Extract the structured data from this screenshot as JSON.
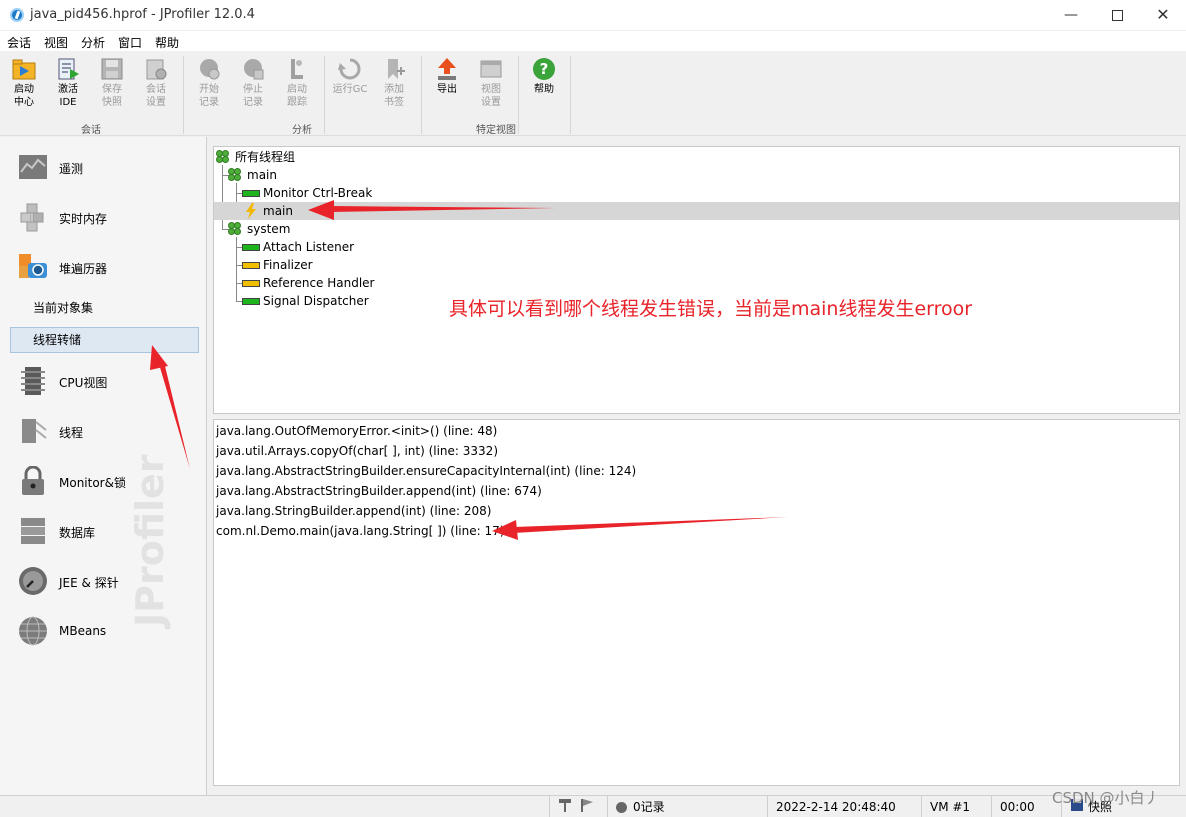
{
  "window": {
    "title": "java_pid456.hprof - JProfiler 12.0.4"
  },
  "menu": [
    "会话",
    "视图",
    "分析",
    "窗口",
    "帮助"
  ],
  "toolbar": {
    "buttons": [
      {
        "line1": "启动",
        "line2": "中心",
        "icon": "start-center-icon",
        "enabled": true
      },
      {
        "line1": "激活",
        "line2": "IDE",
        "icon": "activate-ide-icon",
        "enabled": true
      },
      {
        "line1": "保存",
        "line2": "快照",
        "icon": "save-snapshot-icon",
        "enabled": false
      },
      {
        "line1": "会话",
        "line2": "设置",
        "icon": "session-settings-icon",
        "enabled": false
      },
      {
        "line1": "开始",
        "line2": "记录",
        "icon": "start-recording-icon",
        "enabled": false
      },
      {
        "line1": "停止",
        "line2": "记录",
        "icon": "stop-recording-icon",
        "enabled": false
      },
      {
        "line1": "启动",
        "line2": "跟踪",
        "icon": "start-tracking-icon",
        "enabled": false
      },
      {
        "line1": "运行GC",
        "line2": "",
        "icon": "run-gc-icon",
        "enabled": false
      },
      {
        "line1": "添加",
        "line2": "书签",
        "icon": "add-bookmark-icon",
        "enabled": false
      },
      {
        "line1": "导出",
        "line2": "",
        "icon": "export-icon",
        "enabled": true
      },
      {
        "line1": "视图",
        "line2": "设置",
        "icon": "view-settings-icon",
        "enabled": false
      },
      {
        "line1": "帮助",
        "line2": "",
        "icon": "help-icon",
        "enabled": true
      }
    ],
    "groups": [
      "会话",
      "分析",
      "特定视图"
    ]
  },
  "sidebar": {
    "items": [
      {
        "label": "遥测",
        "icon": "telemetry-icon"
      },
      {
        "label": "实时内存",
        "icon": "live-memory-icon"
      },
      {
        "label": "堆遍历器",
        "icon": "heap-walker-icon"
      },
      {
        "label": "CPU视图",
        "icon": "cpu-view-icon"
      },
      {
        "label": "线程",
        "icon": "threads-icon"
      },
      {
        "label": "Monitor&锁",
        "icon": "monitor-lock-icon"
      },
      {
        "label": "数据库",
        "icon": "database-icon"
      },
      {
        "label": "JEE & 探针",
        "icon": "jee-probes-icon"
      },
      {
        "label": "MBeans",
        "icon": "mbeans-icon"
      }
    ],
    "sub_items": [
      {
        "label": "当前对象集",
        "selected": false
      },
      {
        "label": "线程转储",
        "selected": true
      }
    ],
    "watermark": "JProfiler"
  },
  "threads": {
    "root": "所有线程组",
    "groups": [
      {
        "name": "main",
        "threads": [
          {
            "name": "Monitor Ctrl-Break",
            "state": "green"
          },
          {
            "name": "main",
            "state": "lightning",
            "selected": true
          }
        ]
      },
      {
        "name": "system",
        "threads": [
          {
            "name": "Attach Listener",
            "state": "green"
          },
          {
            "name": "Finalizer",
            "state": "yellow"
          },
          {
            "name": "Reference Handler",
            "state": "yellow"
          },
          {
            "name": "Signal Dispatcher",
            "state": "green"
          }
        ]
      }
    ]
  },
  "annotation": "具体可以看到哪个线程发生错误，当前是main线程发生erroor",
  "stack": [
    "java.lang.OutOfMemoryError.<init>() (line: 48)",
    "java.util.Arrays.copyOf(char[ ], int) (line: 3332)",
    "java.lang.AbstractStringBuilder.ensureCapacityInternal(int) (line: 124)",
    "java.lang.AbstractStringBuilder.append(int) (line: 674)",
    "java.lang.StringBuilder.append(int) (line: 208)",
    "com.nl.Demo.main(java.lang.String[ ]) (line: 17)"
  ],
  "statusbar": {
    "recordings": "0记录",
    "datetime": "2022-2-14 20:48:40",
    "vm": "VM #1",
    "elapsed": "00:00",
    "snapshot": "快照"
  },
  "csdn_watermark": "CSDN @小白丿",
  "colors": {
    "accent_red": "#e8242a",
    "selection": "#d6d6d6",
    "thread_green": "#1db41d",
    "thread_yellow": "#f0c000"
  }
}
